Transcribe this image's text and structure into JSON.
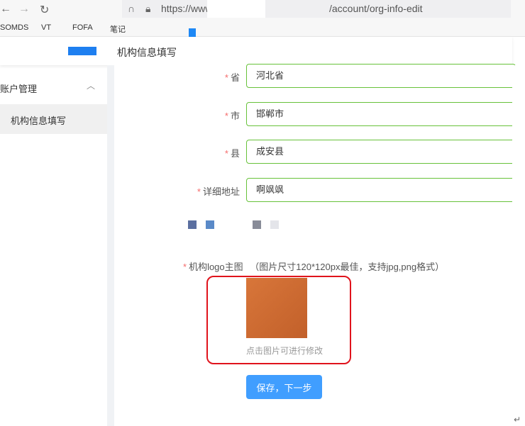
{
  "browser": {
    "url_prefix": "https://www",
    "url_suffix": "/account/org-info-edit",
    "bookmarks": [
      "SOMDS",
      "VT",
      "FOFA",
      "笔记"
    ]
  },
  "header": {
    "title": "机构信息填写"
  },
  "sidebar": {
    "group": "账户管理",
    "items": [
      {
        "label": "机构信息填写",
        "active": true
      }
    ]
  },
  "form": {
    "fields": [
      {
        "label": "省",
        "value": "河北省"
      },
      {
        "label": "市",
        "value": "邯郸市"
      },
      {
        "label": "县",
        "value": "成安县"
      },
      {
        "label": "详细地址",
        "value": "啊飒飒"
      }
    ],
    "logo_label": "机构logo主图",
    "logo_hint": "（图片尺寸120*120px最佳，支持jpg,png格式）",
    "logo_caption": "点击图片可进行修改",
    "submit": "保存，下一步"
  },
  "colors": {
    "accent": "#409eff",
    "valid_border": "#67c23a",
    "required": "#f56c6c",
    "highlight": "#e0131c"
  }
}
